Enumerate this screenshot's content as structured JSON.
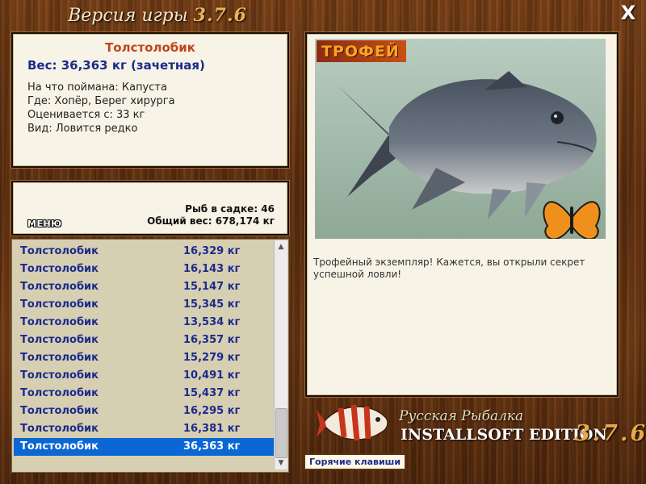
{
  "window": {
    "title_prefix": "Версия игры",
    "title_version": "3.7.6",
    "close_symbol": "X"
  },
  "fish_info": {
    "name": "Толстолобик",
    "weight_line": "Вес: 36,363 кг (зачетная)",
    "lines": [
      "На что поймана: Капуста",
      "Где: Хопёр, Берег хирурга",
      "Оценивается с: 33 кг",
      "Вид: Ловится редко"
    ]
  },
  "stats": {
    "menu_label": "МЕНЮ",
    "fish_count": "Рыб в садке: 46",
    "total_weight": "Общий вес: 678,174 кг"
  },
  "catch_list": {
    "rows": [
      {
        "name": "Толстолобик",
        "weight": "16,329 кг"
      },
      {
        "name": "Толстолобик",
        "weight": "16,143 кг"
      },
      {
        "name": "Толстолобик",
        "weight": "15,147 кг"
      },
      {
        "name": "Толстолобик",
        "weight": "15,345 кг"
      },
      {
        "name": "Толстолобик",
        "weight": "13,534 кг"
      },
      {
        "name": "Толстолобик",
        "weight": "16,357 кг"
      },
      {
        "name": "Толстолобик",
        "weight": "15,279 кг"
      },
      {
        "name": "Толстолобик",
        "weight": "10,491 кг"
      },
      {
        "name": "Толстолобик",
        "weight": "15,437 кг"
      },
      {
        "name": "Толстолобик",
        "weight": "16,295 кг"
      },
      {
        "name": "Толстолобик",
        "weight": "16,381 кг"
      },
      {
        "name": "Толстолобик",
        "weight": "36,363 кг"
      }
    ],
    "selected_index": 11,
    "scroll_position": 1.0
  },
  "trophy_panel": {
    "badge": "ТРОФЕЙ",
    "caption": "Трофейный экземпляр! Кажется, вы открыли секрет успешной ловли!"
  },
  "branding": {
    "line1": "Русская Рыбалка",
    "line2": "INSTALLSOFT EDITION",
    "version": "3.7.6"
  },
  "footer": {
    "hotkeys_label": "Горячие клавиши"
  },
  "colors": {
    "accent_red": "#c0451c",
    "list_blue": "#1c2b8c",
    "selection": "#0a67d4",
    "version_gold": "#e8a84a"
  }
}
